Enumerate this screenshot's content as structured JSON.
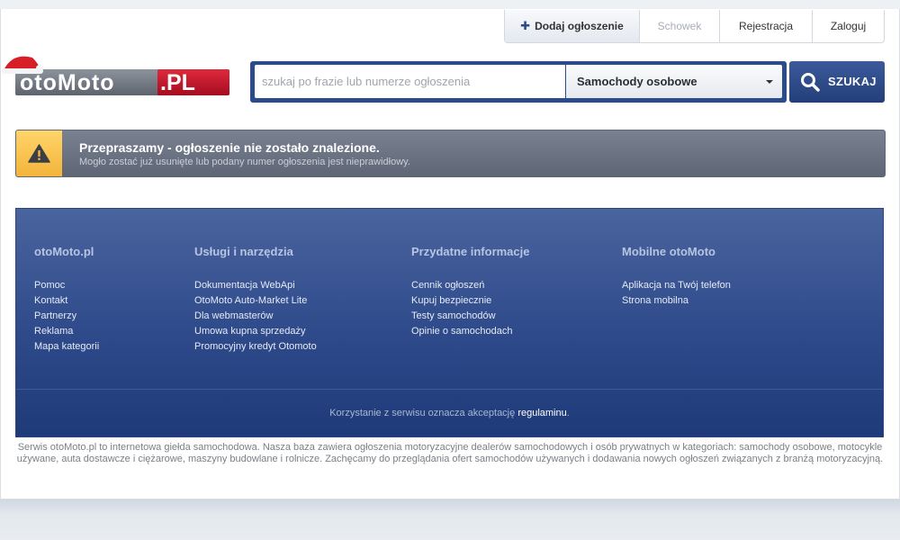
{
  "topnav": {
    "add_label": "Dodaj ogłoszenie",
    "fav_label": "Schowek",
    "register_label": "Rejestracja",
    "login_label": "Zaloguj"
  },
  "logo": {
    "text_main": "otoMoto",
    "text_suffix": ".PL"
  },
  "search": {
    "placeholder": "szukaj po frazie lub numerze ogłoszenia",
    "category": "Samochody osobowe",
    "button_label": "SZUKAJ"
  },
  "alert": {
    "title": "Przepraszamy - ogłoszenie nie zostało znalezione.",
    "message": "Mogło zostać już usunięte lub podany numer ogłoszenia jest nieprawidłowy."
  },
  "footer": {
    "columns": [
      {
        "title": "otoMoto.pl",
        "items": [
          "Pomoc",
          "Kontakt",
          "Partnerzy",
          "Reklama",
          "Mapa kategorii"
        ]
      },
      {
        "title": "Usługi i narzędzia",
        "items": [
          "Dokumentacja WebApi",
          "OtoMoto Auto-Market Lite",
          "Dla webmasterów",
          "Umowa kupna sprzedaży",
          "Promocyjny kredyt Otomoto"
        ]
      },
      {
        "title": "Przydatne informacje",
        "items": [
          "Cennik ogłoszeń",
          "Kupuj bezpiecznie",
          "Testy samochodów",
          "Opinie o samochodach"
        ]
      },
      {
        "title": "Mobilne otoMoto",
        "items": [
          "Aplikacja na Twój telefon",
          "Strona mobilna"
        ]
      }
    ],
    "terms_text": "Korzystanie z serwisu oznacza akceptację",
    "terms_link": "regulaminu",
    "terms_end": "."
  },
  "about_text": "Serwis otoMoto.pl to internetowa giełda samochodowa. Nasza baza zawiera ogłoszenia motoryzacyjne dealerów samochodowych i osób prywatnych w kategoriach: samochody osobowe, motocykle używane, auta dostawcze i ciężarowe, maszyny budowlane i rolnicze. Zachęcamy do przeglądania ofert samochodów używanych i dodawania nowych ogłoszeń związanych z branżą motoryzacyjną.",
  "colors": {
    "brand_blue": "#2b4b8a",
    "footer_blue": "#2e4a8a",
    "alert_gray": "#6a7282",
    "alert_yellow": "#f3b43a",
    "logo_red": "#c8102e"
  }
}
